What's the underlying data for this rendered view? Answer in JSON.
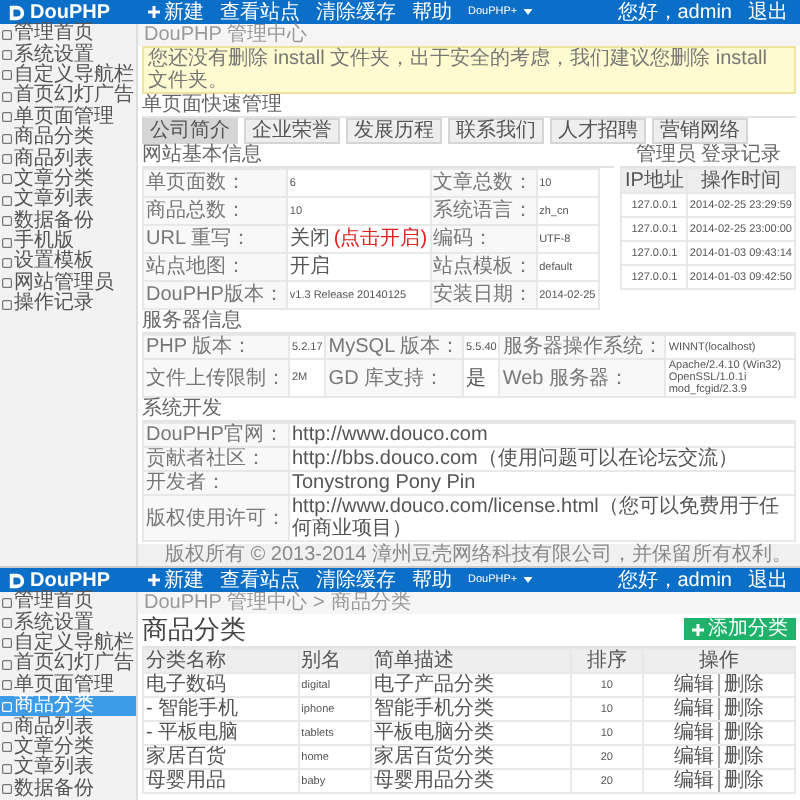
{
  "screens": [
    {
      "header": {
        "logo": "DouPHP",
        "nav": [
          {
            "kind": "add",
            "label": "新建"
          },
          {
            "kind": "link",
            "label": "查看站点"
          },
          {
            "kind": "link",
            "label": "清除缓存"
          },
          {
            "kind": "link",
            "label": "帮助"
          },
          {
            "kind": "dropdown",
            "label": "DouPHP+"
          }
        ],
        "greeting": "您好，admin",
        "logout": "退出"
      },
      "sidebar": [
        {
          "label": "管理首页",
          "selected": false
        },
        {
          "label": "系统设置",
          "selected": false
        },
        {
          "label": "自定义导航栏",
          "selected": false
        },
        {
          "label": "首页幻灯广告",
          "selected": false
        },
        {
          "label": "单页面管理",
          "selected": false
        },
        {
          "label": "商品分类",
          "selected": false
        },
        {
          "label": "商品列表",
          "selected": false
        },
        {
          "label": "文章分类",
          "selected": false
        },
        {
          "label": "文章列表",
          "selected": false
        },
        {
          "label": "数据备份",
          "selected": false
        },
        {
          "label": "手机版",
          "selected": false
        },
        {
          "label": "设置模板",
          "selected": false
        },
        {
          "label": "网站管理员",
          "selected": false
        },
        {
          "label": "操作记录",
          "selected": false
        }
      ],
      "kind": "dashboard",
      "breadcrumb": [
        "DouPHP 管理中心"
      ],
      "notice": "您还没有删除 install 文件夹，出于安全的考虑，我们建议您删除 install 文件夹。",
      "quick_pages": {
        "title": "单页面快速管理",
        "buttons": [
          {
            "label": "公司简介",
            "selected": true
          },
          {
            "label": "企业荣誉",
            "selected": false
          },
          {
            "label": "发展历程",
            "selected": false
          },
          {
            "label": "联系我们",
            "selected": false
          },
          {
            "label": "人才招聘",
            "selected": false
          },
          {
            "label": "营销网络",
            "selected": false
          }
        ]
      },
      "site_info": {
        "title": "网站基本信息",
        "rows": [
          {
            "cells": [
              {
                "label": "单页面数：",
                "value": "6"
              },
              {
                "label": "文章总数：",
                "value": "10"
              }
            ]
          },
          {
            "cells": [
              {
                "label": "商品总数：",
                "value": "10"
              },
              {
                "label": "系统语言：",
                "value": "zh_cn"
              }
            ]
          },
          {
            "cells": [
              {
                "label": "URL 重写：",
                "value": "关闭",
                "link": "(点击开启)"
              },
              {
                "label": "编码：",
                "value": "UTF-8"
              }
            ]
          },
          {
            "cells": [
              {
                "label": "站点地图：",
                "value": "开启"
              },
              {
                "label": "站点模板：",
                "value": "default"
              }
            ]
          },
          {
            "cells": [
              {
                "label": "DouPHP版本：",
                "value": "v1.3 Release 20140125"
              },
              {
                "label": "安装日期：",
                "value": "2014-02-25"
              }
            ]
          }
        ]
      },
      "login_log": {
        "title": "管理员 登录记录",
        "columns": [
          "IP地址",
          "操作时间"
        ],
        "rows": [
          [
            "127.0.0.1",
            "2014-02-25 23:29:59"
          ],
          [
            "127.0.0.1",
            "2014-02-25 23:00:00"
          ],
          [
            "127.0.0.1",
            "2014-01-03 09:43:14"
          ],
          [
            "127.0.0.1",
            "2014-01-03 09:42:50"
          ]
        ]
      },
      "server_info": {
        "title": "服务器信息",
        "rows": [
          {
            "cells": [
              {
                "label": "PHP 版本：",
                "value": "5.2.17"
              },
              {
                "label": "MySQL 版本：",
                "value": "5.5.40"
              },
              {
                "label": "服务器操作系统：",
                "value": "WINNT(localhost)"
              }
            ]
          },
          {
            "cells": [
              {
                "label": "文件上传限制：",
                "value": "2M"
              },
              {
                "label": "GD 库支持：",
                "value": "是"
              },
              {
                "label": "Web 服务器：",
                "value": "Apache/2.4.10 (Win32) OpenSSL/1.0.1i mod_fcgid/2.3.9"
              }
            ]
          }
        ]
      },
      "system_dev": {
        "title": "系统开发",
        "rows": [
          {
            "label": "DouPHP官网：",
            "value": "http://www.douco.com"
          },
          {
            "label": "贡献者社区：",
            "value": "http://bbs.douco.com（使用问题可以在论坛交流）"
          },
          {
            "label": "开发者：",
            "value": "Tonystrong Pony Pin"
          },
          {
            "label": "版权使用许可：",
            "value": "http://www.douco.com/license.html（您可以免费用于任何商业项目）"
          }
        ]
      },
      "footer": "版权所有 © 2013-2014 漳州豆壳网络科技有限公司，并保留所有权利。"
    },
    {
      "header": {
        "logo": "DouPHP",
        "nav": [
          {
            "kind": "add",
            "label": "新建"
          },
          {
            "kind": "link",
            "label": "查看站点"
          },
          {
            "kind": "link",
            "label": "清除缓存"
          },
          {
            "kind": "link",
            "label": "帮助"
          },
          {
            "kind": "dropdown",
            "label": "DouPHP+"
          }
        ],
        "greeting": "您好，admin",
        "logout": "退出"
      },
      "sidebar": [
        {
          "label": "管理首页",
          "selected": false
        },
        {
          "label": "系统设置",
          "selected": false
        },
        {
          "label": "自定义导航栏",
          "selected": false
        },
        {
          "label": "首页幻灯广告",
          "selected": false
        },
        {
          "label": "单页面管理",
          "selected": false
        },
        {
          "label": "商品分类",
          "selected": true
        },
        {
          "label": "商品列表",
          "selected": false
        },
        {
          "label": "文章分类",
          "selected": false
        },
        {
          "label": "文章列表",
          "selected": false
        },
        {
          "label": "数据备份",
          "selected": false
        }
      ],
      "kind": "category_list",
      "breadcrumb": [
        "DouPHP 管理中心",
        "商品分类"
      ],
      "breadcrumb_separator": ">",
      "title": "商品分类",
      "add_button": "添加分类",
      "table": {
        "columns": [
          "分类名称",
          "别名",
          "简单描述",
          "排序",
          "操作"
        ],
        "rows": [
          {
            "name": "电子数码",
            "alias": "digital",
            "description": "电子产品分类",
            "sort": "10",
            "actions": [
              "编辑",
              "删除"
            ]
          },
          {
            "name": "- 智能手机",
            "alias": "iphone",
            "description": "智能手机分类",
            "sort": "10",
            "actions": [
              "编辑",
              "删除"
            ]
          },
          {
            "name": "- 平板电脑",
            "alias": "tablets",
            "description": "平板电脑分类",
            "sort": "10",
            "actions": [
              "编辑",
              "删除"
            ]
          },
          {
            "name": "家居百货",
            "alias": "home",
            "description": "家居百货分类",
            "sort": "20",
            "actions": [
              "编辑",
              "删除"
            ]
          },
          {
            "name": "母婴用品",
            "alias": "baby",
            "description": "母婴用品分类",
            "sort": "20",
            "actions": [
              "编辑",
              "删除"
            ]
          }
        ]
      }
    }
  ]
}
